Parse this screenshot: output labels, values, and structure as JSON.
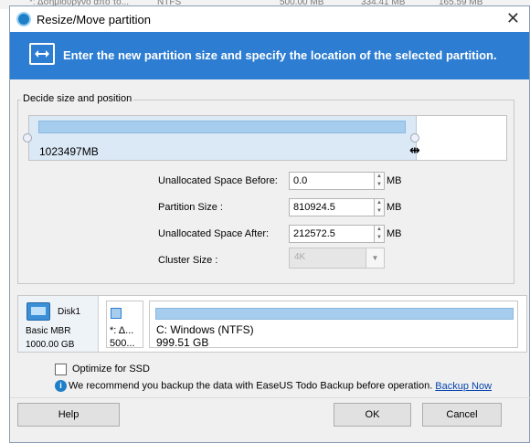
{
  "background": {
    "row_text": [
      "*: Δσημιουργνό από το...",
      "NTFS",
      "500.00 MB",
      "334.41 MB",
      "165.59 MB"
    ]
  },
  "window": {
    "title": "Resize/Move partition",
    "banner_text": "Enter the new partition size and specify the location of the selected partition."
  },
  "size_group": {
    "legend": "Decide size and position",
    "partition_size_display": "1023497MB",
    "fields": [
      {
        "label": "Unallocated Space Before:",
        "value": "0.0",
        "unit": "MB"
      },
      {
        "label": "Partition Size :",
        "value": "810924.5",
        "unit": "MB"
      },
      {
        "label": "Unallocated Space After:",
        "value": "212572.5",
        "unit": "MB"
      }
    ],
    "cluster_label": "Cluster Size :",
    "cluster_value": "4K"
  },
  "disk_map": {
    "disk_name": "Disk1",
    "disk_type": "Basic MBR",
    "disk_capacity": "1000.00 GB",
    "partitions": [
      {
        "label": "*: Δ...",
        "size": "500..."
      },
      {
        "label": "C: Windows (NTFS)",
        "size": "999.51 GB"
      }
    ]
  },
  "options": {
    "optimize_ssd_label": "Optimize for SSD",
    "optimize_ssd_checked": false,
    "info_text": "We recommend you backup the data with EaseUS Todo Backup before operation.",
    "backup_link": "Backup Now"
  },
  "buttons": {
    "help": "Help",
    "ok": "OK",
    "cancel": "Cancel"
  },
  "colors": {
    "banner": "#2d7dd2",
    "partition_fill": "#a6cdee"
  }
}
